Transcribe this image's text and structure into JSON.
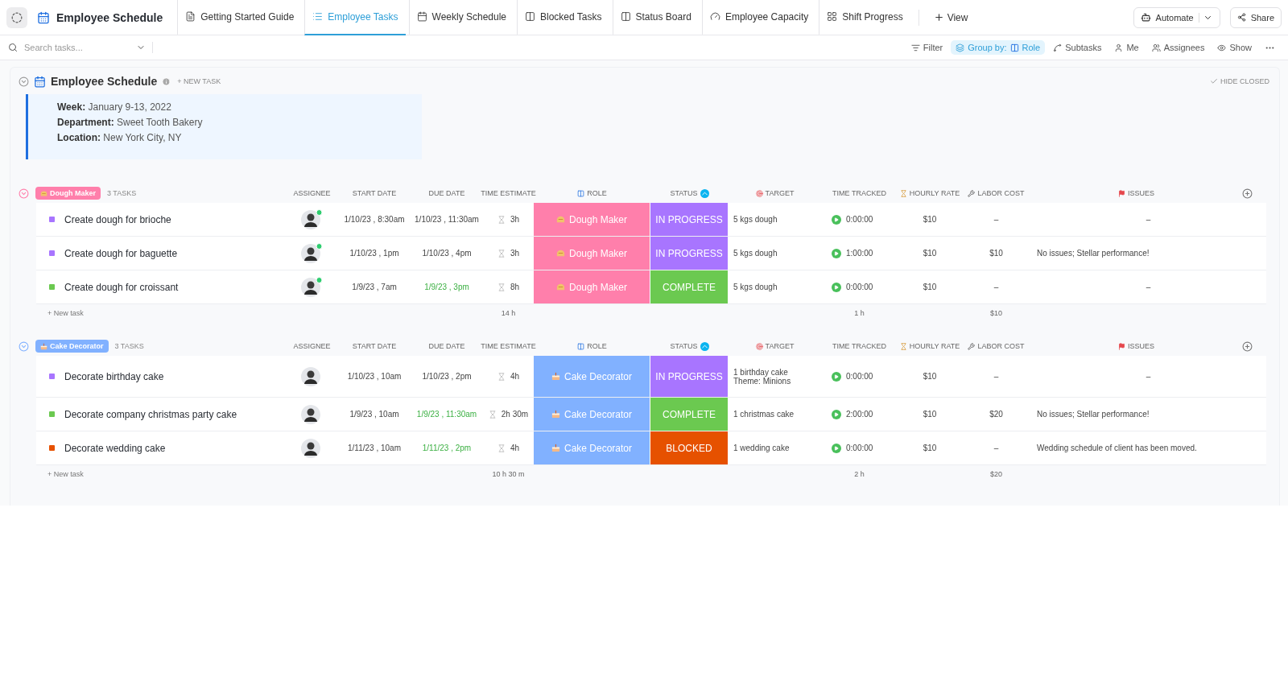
{
  "workspace_title": "Employee Schedule",
  "tabs": [
    {
      "label": "Getting Started Guide",
      "selected": false
    },
    {
      "label": "Employee Tasks",
      "selected": true
    },
    {
      "label": "Weekly Schedule",
      "selected": false
    },
    {
      "label": "Blocked Tasks",
      "selected": false
    },
    {
      "label": "Status Board",
      "selected": false
    },
    {
      "label": "Employee Capacity",
      "selected": false
    },
    {
      "label": "Shift Progress",
      "selected": false
    }
  ],
  "add_view": "View",
  "automate": "Automate",
  "share": "Share",
  "search": {
    "placeholder": "Search tasks..."
  },
  "toolbar": {
    "filter": "Filter",
    "group_by_label": "Group by:",
    "group_by_value": "Role",
    "subtasks": "Subtasks",
    "me": "Me",
    "assignees": "Assignees",
    "show": "Show"
  },
  "list": {
    "title": "Employee Schedule",
    "new_task": "+ NEW TASK",
    "hide_closed": "HIDE CLOSED",
    "description": [
      {
        "label": "Week:",
        "value": "January 9-13, 2022"
      },
      {
        "label": "Department:",
        "value": "Sweet Tooth Bakery"
      },
      {
        "label": "Location:",
        "value": "New York City, NY"
      }
    ]
  },
  "groups": [
    {
      "name": "Dough Maker",
      "color": "#ff7fab",
      "count": "3 TASKS",
      "online": true,
      "columns": [
        "ASSIGNEE",
        "START DATE",
        "DUE DATE",
        "TIME ESTIMATE",
        "ROLE",
        "STATUS",
        "TARGET",
        "TIME TRACKED",
        "HOURLY RATE",
        "LABOR COST",
        "ISSUES"
      ],
      "tasks": [
        {
          "name": "Create dough for brioche",
          "start": "1/10/23 , 8:30am",
          "due": "1/10/23 , 11:30am",
          "due_on_time": false,
          "estimate": "3h",
          "role": "Dough Maker",
          "status": "IN PROGRESS",
          "kind": "in_progress",
          "target": "5 kgs dough",
          "tracked": "0:00:00",
          "rate": "$10",
          "labor": "–",
          "issues": "–"
        },
        {
          "name": "Create dough for baguette",
          "start": "1/10/23 , 1pm",
          "due": "1/10/23 , 4pm",
          "due_on_time": false,
          "estimate": "3h",
          "role": "Dough Maker",
          "status": "IN PROGRESS",
          "kind": "in_progress",
          "target": "5 kgs dough",
          "tracked": "1:00:00",
          "rate": "$10",
          "labor": "$10",
          "issues": "No issues; Stellar performance!"
        },
        {
          "name": "Create dough for croissant",
          "start": "1/9/23 , 7am",
          "due": "1/9/23 , 3pm",
          "due_on_time": true,
          "estimate": "8h",
          "role": "Dough Maker",
          "status": "COMPLETE",
          "kind": "complete",
          "target": "5 kgs dough",
          "tracked": "0:00:00",
          "rate": "$10",
          "labor": "–",
          "issues": "–"
        }
      ],
      "footer": {
        "new_task": "+ New task",
        "estimate": "14 h",
        "tracked": "1 h",
        "labor": "$10"
      }
    },
    {
      "name": "Cake Decorator",
      "color": "#81b1ff",
      "count": "3 TASKS",
      "online": false,
      "columns": [
        "ASSIGNEE",
        "START DATE",
        "DUE DATE",
        "TIME ESTIMATE",
        "ROLE",
        "STATUS",
        "TARGET",
        "TIME TRACKED",
        "HOURLY RATE",
        "LABOR COST",
        "ISSUES"
      ],
      "tasks": [
        {
          "name": "Decorate birthday cake",
          "start": "1/10/23 , 10am",
          "due": "1/10/23 , 2pm",
          "due_on_time": false,
          "estimate": "4h",
          "role": "Cake Decorator",
          "status": "IN PROGRESS",
          "kind": "in_progress",
          "target": "1 birthday cake Theme: Minions",
          "tracked": "0:00:00",
          "rate": "$10",
          "labor": "–",
          "issues": "–"
        },
        {
          "name": "Decorate company christmas party cake",
          "start": "1/9/23 , 10am",
          "due": "1/9/23 , 11:30am",
          "due_on_time": true,
          "estimate": "2h 30m",
          "role": "Cake Decorator",
          "status": "COMPLETE",
          "kind": "complete",
          "target": "1 christmas cake",
          "tracked": "2:00:00",
          "rate": "$10",
          "labor": "$20",
          "issues": "No issues; Stellar performance!"
        },
        {
          "name": "Decorate wedding cake",
          "start": "1/11/23 , 10am",
          "due": "1/11/23 , 2pm",
          "due_on_time": true,
          "estimate": "4h",
          "role": "Cake Decorator",
          "status": "BLOCKED",
          "kind": "blocked",
          "target": "1 wedding cake",
          "tracked": "0:00:00",
          "rate": "$10",
          "labor": "–",
          "issues": "Wedding schedule of client has been moved."
        }
      ],
      "footer": {
        "new_task": "+ New task",
        "estimate": "10 h 30 m",
        "tracked": "2 h",
        "labor": "$20"
      }
    }
  ]
}
